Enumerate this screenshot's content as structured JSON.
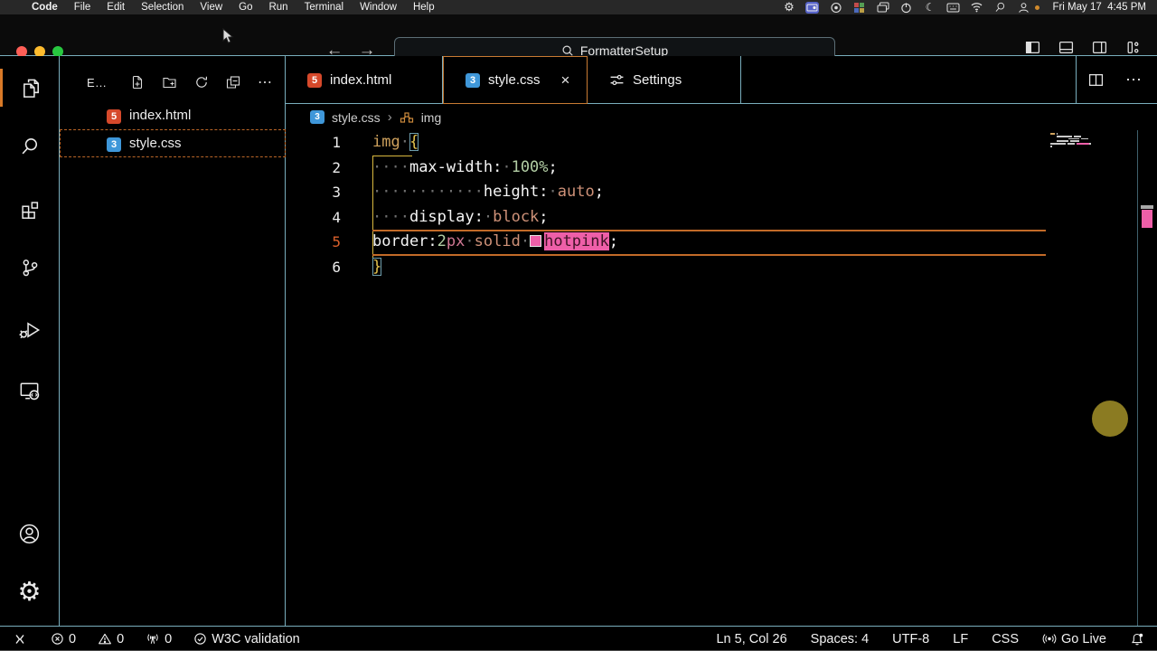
{
  "menu_bar": {
    "apple": "",
    "items": [
      "Code",
      "File",
      "Edit",
      "Selection",
      "View",
      "Go",
      "Run",
      "Terminal",
      "Window",
      "Help"
    ],
    "status_icons": [
      "gear-icon",
      "screen-mirroring-icon",
      "screen-record-icon",
      "app-grid-icon",
      "windows-icon",
      "power-icon",
      "moon-icon",
      "keyboard-icon",
      "wifi-icon",
      "search-icon",
      "user-icon"
    ],
    "clock": "Fri May 17  4:45 PM"
  },
  "title_bar": {
    "search_value": "FormatterSetup",
    "window_icons": [
      "toggle-sidebar-icon",
      "toggle-panel-icon",
      "toggle-secondary-sidebar-icon",
      "customize-layout-icon"
    ]
  },
  "activity_bar": {
    "top": [
      {
        "name": "explorer",
        "icon": "files-icon",
        "active": true
      },
      {
        "name": "search",
        "icon": "search-icon",
        "active": false
      },
      {
        "name": "extensions",
        "icon": "extensions-icon",
        "active": false
      },
      {
        "name": "source-control",
        "icon": "source-control-icon",
        "active": false
      },
      {
        "name": "run-debug",
        "icon": "run-debug-icon",
        "active": false
      },
      {
        "name": "live-preview",
        "icon": "live-preview-icon",
        "active": false
      }
    ],
    "bottom": [
      {
        "name": "account",
        "icon": "account-icon",
        "active": false
      },
      {
        "name": "settings",
        "icon": "settings-gear-icon",
        "active": false
      }
    ]
  },
  "explorer": {
    "title": "E…",
    "actions": [
      "new-file-icon",
      "new-folder-icon",
      "refresh-icon",
      "collapse-all-icon",
      "more-icon"
    ],
    "files": [
      {
        "label": "index.html",
        "icon": "html-badge",
        "selected": false
      },
      {
        "label": "style.css",
        "icon": "css-badge",
        "selected": true
      }
    ]
  },
  "tabs": [
    {
      "label": "index.html",
      "icon": "html-badge",
      "active": false,
      "closable": false
    },
    {
      "label": "style.css",
      "icon": "css-badge",
      "active": true,
      "closable": true
    },
    {
      "label": "Settings",
      "icon": "settings-sliders-icon",
      "active": false,
      "closable": false
    }
  ],
  "breadcrumb": {
    "file": "style.css",
    "separator": "›",
    "symbol": "img"
  },
  "editor": {
    "active_line": 5,
    "lines": [
      {
        "num": "1",
        "tokens": [
          {
            "t": "img",
            "c": "tag"
          },
          {
            "t": "·",
            "c": "ws"
          },
          {
            "t": "{",
            "c": "brace-match"
          }
        ]
      },
      {
        "num": "2",
        "tokens": [
          {
            "t": "····",
            "c": "ws"
          },
          {
            "t": "max-width",
            "c": "prop"
          },
          {
            "t": ":",
            "c": "punct"
          },
          {
            "t": "·",
            "c": "ws"
          },
          {
            "t": "100%",
            "c": "num"
          },
          {
            "t": ";",
            "c": "punct"
          }
        ]
      },
      {
        "num": "3",
        "tokens": [
          {
            "t": "············",
            "c": "ws"
          },
          {
            "t": "height",
            "c": "prop"
          },
          {
            "t": ":",
            "c": "punct"
          },
          {
            "t": "·",
            "c": "ws"
          },
          {
            "t": "auto",
            "c": "val"
          },
          {
            "t": ";",
            "c": "punct"
          }
        ]
      },
      {
        "num": "4",
        "tokens": [
          {
            "t": "····",
            "c": "ws"
          },
          {
            "t": "display",
            "c": "prop"
          },
          {
            "t": ":",
            "c": "punct"
          },
          {
            "t": "·",
            "c": "ws"
          },
          {
            "t": "block",
            "c": "val"
          },
          {
            "t": ";",
            "c": "punct"
          }
        ]
      },
      {
        "num": "5",
        "tokens": [
          {
            "t": "border",
            "c": "prop"
          },
          {
            "t": ":",
            "c": "punct"
          },
          {
            "t": "2",
            "c": "num"
          },
          {
            "t": "px",
            "c": "unit"
          },
          {
            "t": "·",
            "c": "ws"
          },
          {
            "t": "solid",
            "c": "val"
          },
          {
            "t": "·",
            "c": "ws"
          },
          {
            "t": "",
            "c": "swatch"
          },
          {
            "t": "hotpink",
            "c": "hotpink-highlight"
          },
          {
            "t": ";",
            "c": "punct"
          }
        ]
      },
      {
        "num": "6",
        "tokens": [
          {
            "t": "}",
            "c": "brace-match"
          }
        ]
      }
    ]
  },
  "status_bar": {
    "left": [
      {
        "name": "remote",
        "icon": "remote-icon",
        "label": ""
      },
      {
        "name": "errors",
        "icon": "error-icon",
        "label": "0"
      },
      {
        "name": "warnings",
        "icon": "warning-icon",
        "label": "0"
      },
      {
        "name": "ports",
        "icon": "ports-icon",
        "label": "0"
      },
      {
        "name": "w3c-validation",
        "icon": "check-icon",
        "label": "W3C validation"
      }
    ],
    "right": [
      {
        "name": "cursor-position",
        "icon": "",
        "label": "Ln 5, Col 26"
      },
      {
        "name": "indentation",
        "icon": "",
        "label": "Spaces: 4"
      },
      {
        "name": "encoding",
        "icon": "",
        "label": "UTF-8"
      },
      {
        "name": "eol",
        "icon": "",
        "label": "LF"
      },
      {
        "name": "language-mode",
        "icon": "",
        "label": "CSS"
      },
      {
        "name": "go-live",
        "icon": "broadcast-icon",
        "label": "Go Live"
      },
      {
        "name": "notifications",
        "icon": "bell-icon",
        "label": ""
      }
    ]
  },
  "colors": {
    "contrast_border": "#79aebd",
    "active_border_orange": "#c87a33",
    "focus_dashed_orange": "#bb6627",
    "current_line_border": "#c26a28",
    "hotpink_highlight": "#ee5fa8",
    "bracket_yellow": "#e3c24e",
    "number_green": "#b3cea5",
    "unit_pink": "#cf7793",
    "value_salmon": "#ce9178",
    "tag_tan": "#cfa25d",
    "html_badge": "#d6492b",
    "css_badge": "#3f97d9",
    "screencast_dot": "#8b7b22"
  }
}
